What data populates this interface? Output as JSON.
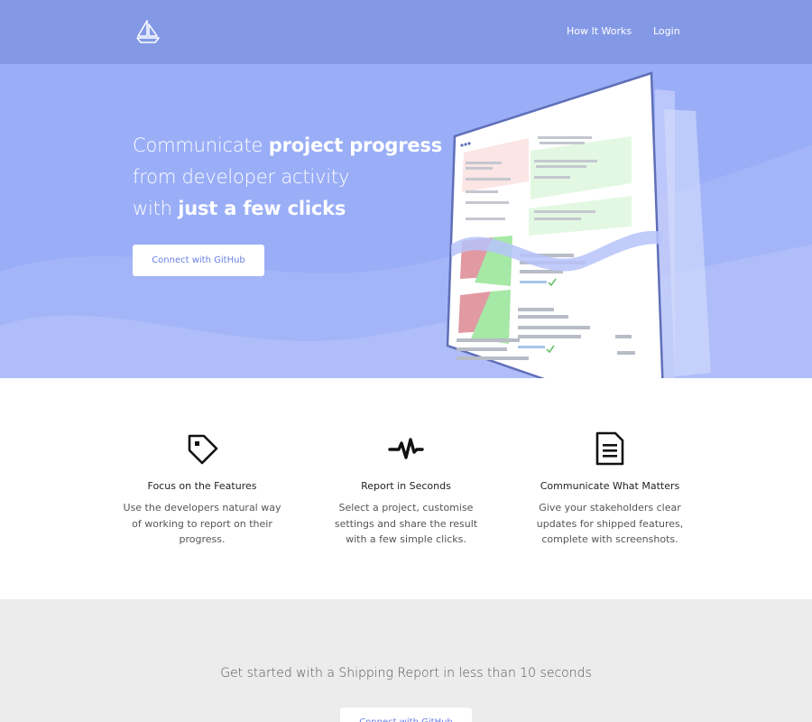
{
  "header": {
    "logo": "sailboat-logo",
    "nav": [
      "How It Works",
      "Login"
    ]
  },
  "hero": {
    "title_line1_a": "Communicate ",
    "title_line1_b": "project progress",
    "title_line2": "from developer activity",
    "title_line3_a": "with ",
    "title_line3_b": "just a few clicks",
    "cta": "Connect with GitHub"
  },
  "features": [
    {
      "icon": "tag-icon",
      "title": "Focus on the Features",
      "desc": "Use the developers natural way of working to report on their progress."
    },
    {
      "icon": "pulse-icon",
      "title": "Report in Seconds",
      "desc": "Select a project, customise settings and share the result with a few simple clicks."
    },
    {
      "icon": "document-icon",
      "title": "Communicate What Matters",
      "desc": "Give your stakeholders clear updates for shipped features, complete with screenshots."
    }
  ],
  "bottom": {
    "text": "Get started with a Shipping Report in less than 10 seconds",
    "cta": "Connect with GitHub"
  },
  "colors": {
    "header": "#8499e6",
    "hero": "#9aaef7",
    "button_text": "#6a7fe0",
    "bottom_bg": "#ececec"
  }
}
